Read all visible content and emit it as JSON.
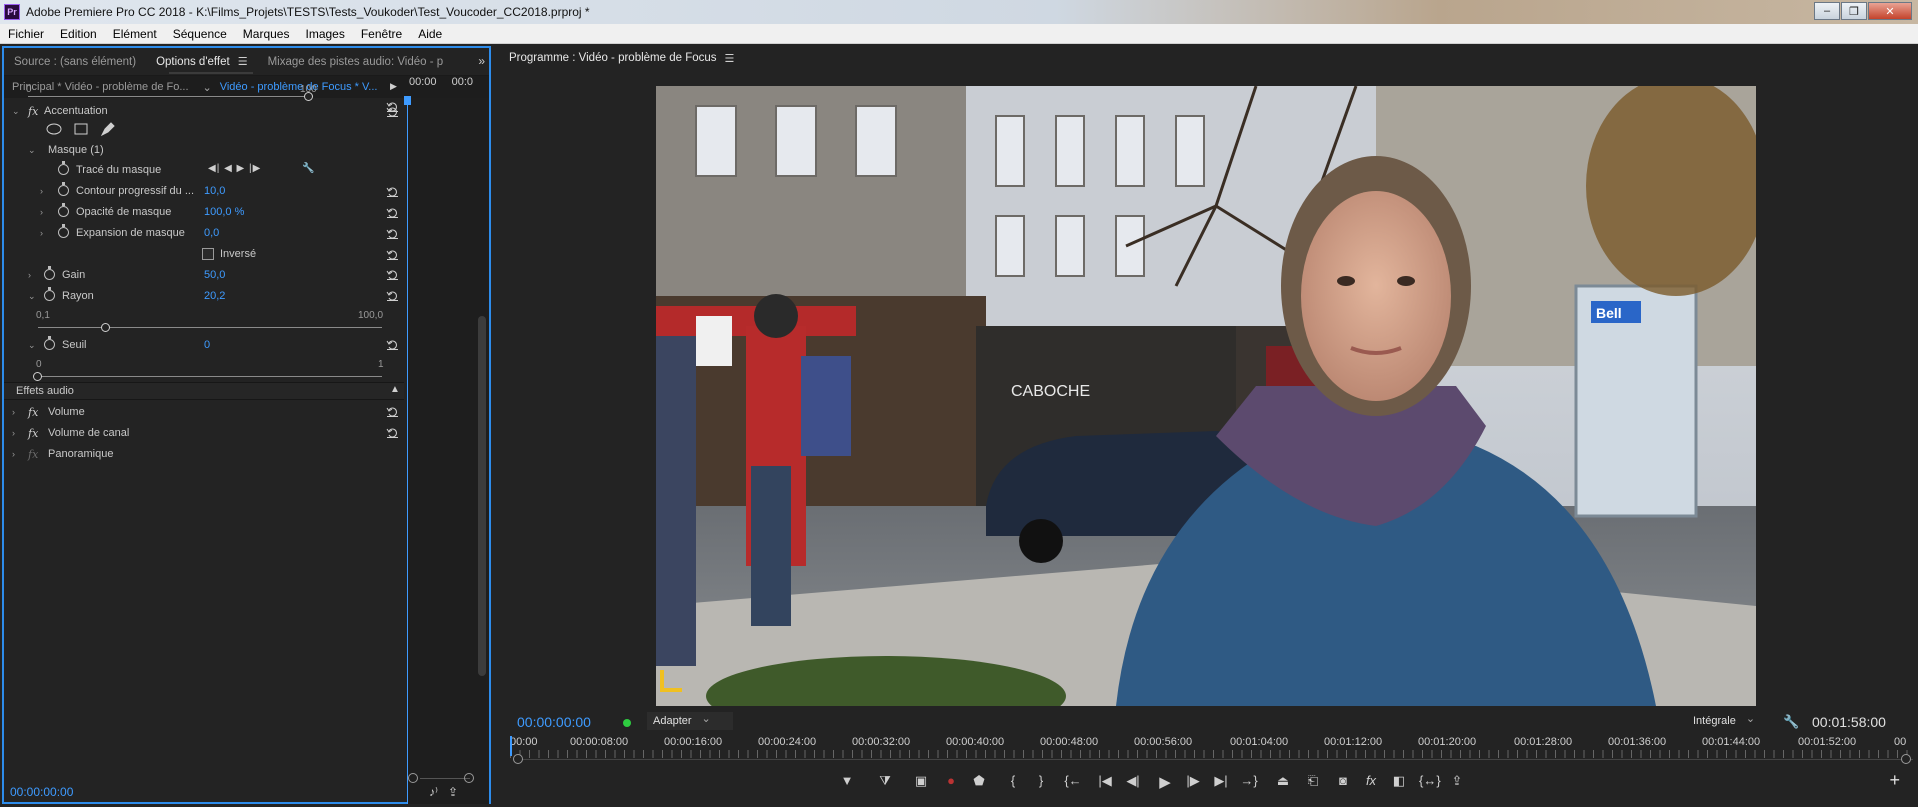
{
  "window": {
    "title": "Adobe Premiere Pro CC 2018 - K:\\Films_Projets\\TESTS\\Tests_Voukoder\\Test_Voucoder_CC2018.prproj *",
    "app_icon": "Pr",
    "min": "–",
    "max": "❐",
    "close": "✕"
  },
  "menu": [
    "Fichier",
    "Edition",
    "Elément",
    "Séquence",
    "Marques",
    "Images",
    "Fenêtre",
    "Aide"
  ],
  "left_panel": {
    "tabs": [
      "Source : (sans élément)",
      "Options d'effet",
      "Mixage des pistes audio: Vidéo - p"
    ],
    "overflow": "»",
    "seq_tabs": [
      "Principal * Vidéo - problème de Fo...",
      "Vidéo - problème de Focus * V..."
    ],
    "ruler": [
      "00:00",
      "00:0"
    ],
    "top_value": "100",
    "accentuation": "Accentuation",
    "masque": "Masque (1)",
    "trace": "Tracé du masque",
    "mask_controls": "◀| ◀ ▶ |▶",
    "contour": {
      "label": "Contour progressif du ...",
      "value": "10,0"
    },
    "opacite": {
      "label": "Opacité de masque",
      "value": "100,0 %"
    },
    "expansion": {
      "label": "Expansion de masque",
      "value": "0,0"
    },
    "inverse": "Inversé",
    "gain": {
      "label": "Gain",
      "value": "50,0"
    },
    "rayon": {
      "label": "Rayon",
      "value": "20,2",
      "min": "0,1",
      "max": "100,0"
    },
    "seuil": {
      "label": "Seuil",
      "value": "0",
      "min": "0",
      "max": "1"
    },
    "effets_audio": "Effets audio",
    "volume": "Volume",
    "volume_canal": "Volume de canal",
    "panoramique": "Panoramique",
    "timecode": "00:00:00:00"
  },
  "program": {
    "title": "Programme : Vidéo - problème de Focus",
    "timecode": "00:00:00:00",
    "fit": "Adapter",
    "quality": "Intégrale",
    "duration": "00:01:58:00",
    "ruler": [
      "00:00",
      "00:00:08:00",
      "00:00:16:00",
      "00:00:24:00",
      "00:00:32:00",
      "00:00:40:00",
      "00:00:48:00",
      "00:00:56:00",
      "00:01:04:00",
      "00:01:12:00",
      "00:01:20:00",
      "00:01:28:00",
      "00:01:36:00",
      "00:01:44:00",
      "00:01:52:00",
      "00"
    ],
    "video": {
      "sign_caboche": "CABOCHE",
      "sign_bell": "Bell"
    }
  },
  "colors": {
    "accent": "#3e9bff",
    "panel": "#232323",
    "focus": "#2d8ceb"
  }
}
